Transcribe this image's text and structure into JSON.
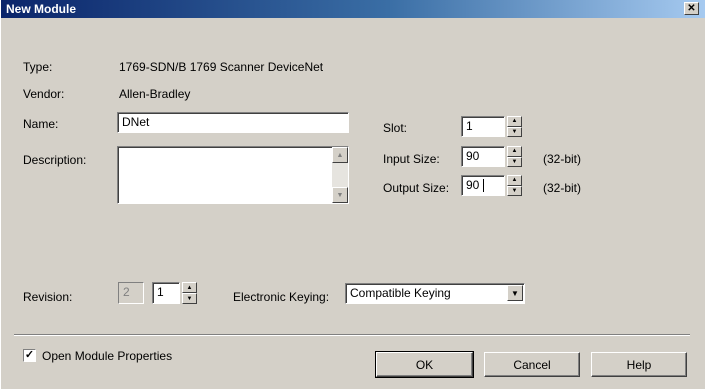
{
  "window": {
    "title": "New Module",
    "close_glyph": "✕"
  },
  "module": {
    "type_label": "Type:",
    "type_value": "1769-SDN/B 1769 Scanner DeviceNet",
    "vendor_label": "Vendor:",
    "vendor_value": "Allen-Bradley",
    "name_label": "Name:",
    "name_value": "DNet",
    "description_label": "Description:",
    "description_value": ""
  },
  "io": {
    "slot_label": "Slot:",
    "slot_value": "1",
    "input_size_label": "Input Size:",
    "input_size_value": "90",
    "input_unit": "(32-bit)",
    "output_size_label": "Output Size:",
    "output_size_value": "90",
    "output_unit": "(32-bit)"
  },
  "revision": {
    "label": "Revision:",
    "major": "2",
    "minor": "1",
    "keying_label": "Electronic Keying:",
    "keying_value": "Compatible Keying"
  },
  "footer": {
    "open_props_label": "Open Module Properties",
    "open_props_checked": true,
    "ok_label": "OK",
    "cancel_label": "Cancel",
    "help_label": "Help"
  },
  "colors": {
    "title_start": "#0a246a",
    "title_end": "#a6caf0",
    "dialog_bg": "#d4d0c8"
  }
}
